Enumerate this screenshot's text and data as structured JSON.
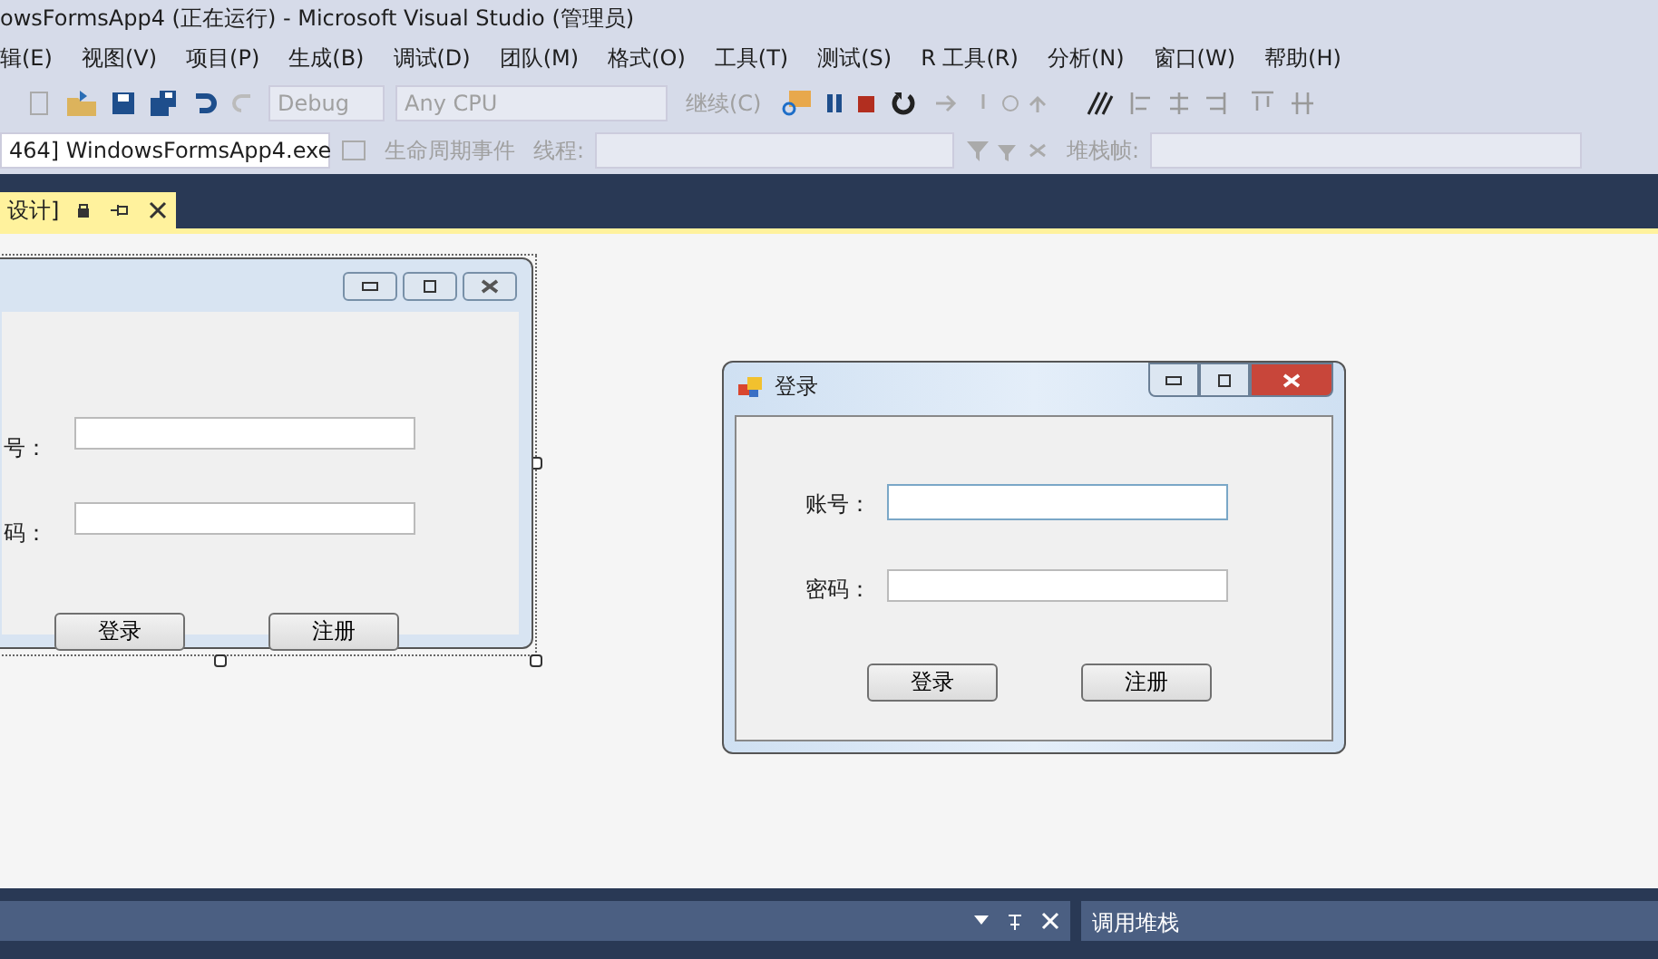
{
  "window": {
    "title": "owsFormsApp4 (正在运行) - Microsoft Visual Studio (管理员)"
  },
  "menu": [
    "辑(E)",
    "视图(V)",
    "项目(P)",
    "生成(B)",
    "调试(D)",
    "团队(M)",
    "格式(O)",
    "工具(T)",
    "测试(S)",
    "R 工具(R)",
    "分析(N)",
    "窗口(W)",
    "帮助(H)"
  ],
  "toolbar": {
    "configuration": "Debug",
    "platform": "Any CPU",
    "continue": "继续(C)"
  },
  "debug_toolbar": {
    "process": "464] WindowsFormsApp4.exe",
    "lifecycle": "生命周期事件",
    "thread_label": "线程:",
    "stack_frame_label": "堆栈帧:"
  },
  "document_tab": {
    "label": "设计]",
    "selected": true
  },
  "designer_form": {
    "account_label": "号：",
    "password_label": "码：",
    "buttons": [
      "登录",
      "注册"
    ]
  },
  "running_form": {
    "title": "登录",
    "account_label": "账号：",
    "password_label": "密码：",
    "buttons": [
      "登录",
      "注册"
    ]
  },
  "bottom_panels": {
    "right_title": "调用堆栈"
  }
}
